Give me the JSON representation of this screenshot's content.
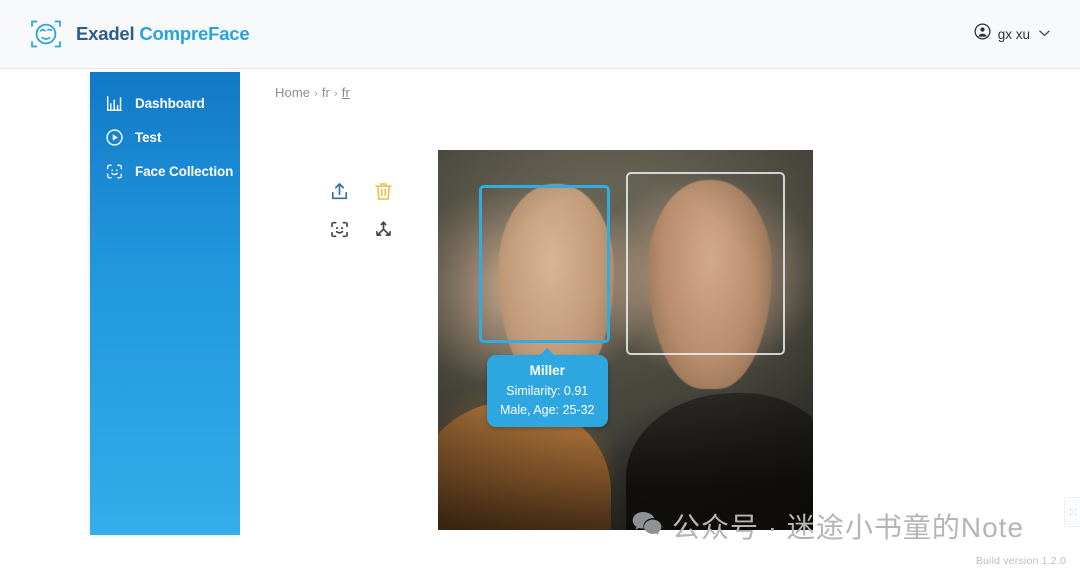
{
  "header": {
    "brand_primary": "Exadel ",
    "brand_secondary": "CompreFace",
    "logo_icon": "face-scan-logo-icon",
    "user": {
      "name": "gx xu",
      "avatar_icon": "account-circle-icon",
      "chevron_icon": "chevron-down-icon",
      "chevron_glyph": "⌄"
    }
  },
  "sidebar": {
    "items": [
      {
        "label": "Dashboard",
        "icon": "bar-chart-icon"
      },
      {
        "label": "Test",
        "icon": "play-circle-icon"
      },
      {
        "label": "Face Collection",
        "icon": "face-scan-icon"
      }
    ]
  },
  "main": {
    "breadcrumb": {
      "home": "Home",
      "sep1": "›",
      "level1": "fr",
      "sep2": "›",
      "current": "fr"
    },
    "tools": [
      {
        "name": "upload-button",
        "icon": "upload-icon",
        "color": "#2e7199"
      },
      {
        "name": "delete-button",
        "icon": "trash-icon",
        "color": "#e8c44d"
      },
      {
        "name": "face-detect-button",
        "icon": "face-scan-icon",
        "color": "#3f444b"
      },
      {
        "name": "branch-button",
        "icon": "share-node-icon",
        "color": "#3f444b"
      }
    ],
    "detection": {
      "boxes": [
        {
          "name": "face-box-selected",
          "state": "selected"
        },
        {
          "name": "face-box-unselected",
          "state": "unselected"
        }
      ],
      "tooltip": {
        "subject": "Miller",
        "similarity": "Similarity: 0.91",
        "demographics": "Male, Age: 25-32"
      }
    }
  },
  "watermark": {
    "icon": "wechat-icon",
    "text": "公众号 · 迷途小书童的Note"
  },
  "footer": {
    "build_version": "Build version 1.2.0"
  },
  "colors": {
    "accent_blue": "#2ea7e0",
    "brand_dark": "#2d5d8a",
    "sidebar_top": "#1279c6",
    "sidebar_bottom": "#34ade9",
    "trash_yellow": "#e8c44d"
  }
}
